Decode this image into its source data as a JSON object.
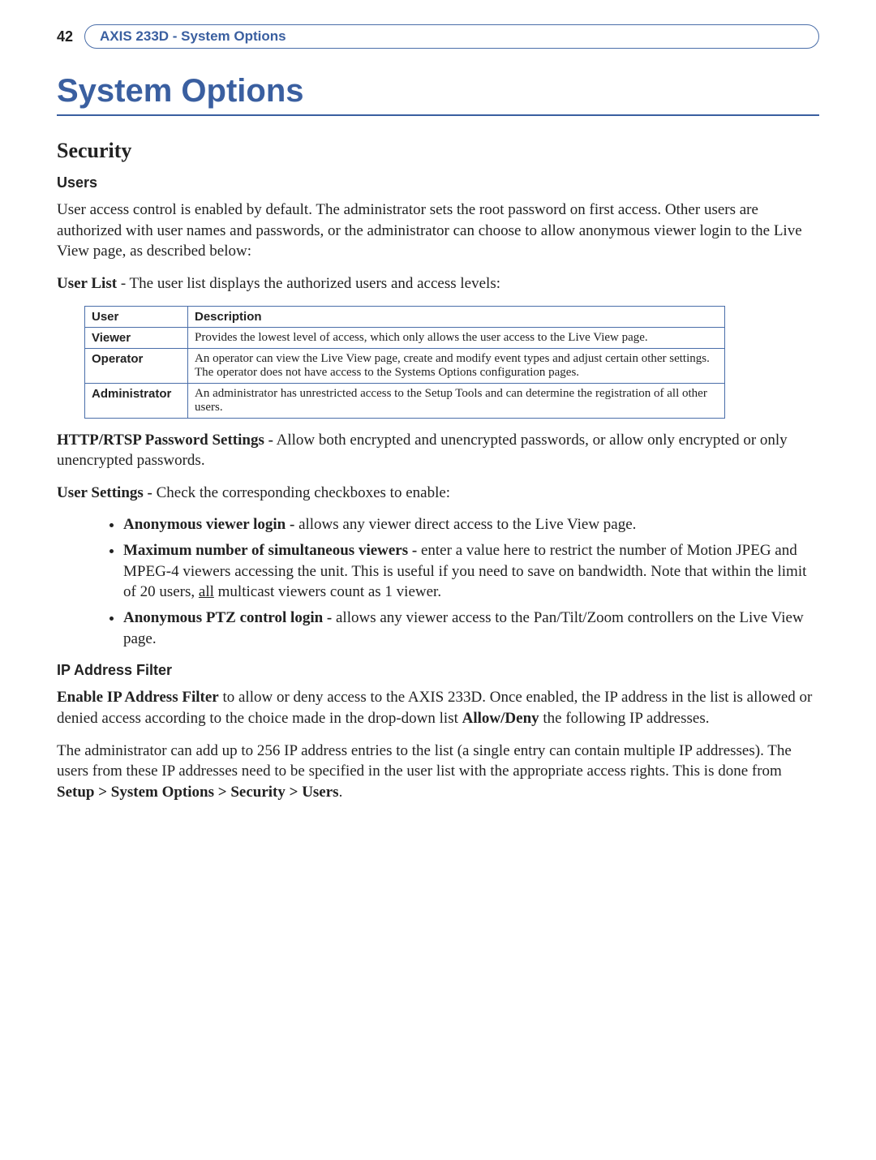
{
  "header": {
    "page_number": "42",
    "running_head": "AXIS 233D - System Options"
  },
  "title": "System Options",
  "security": {
    "heading": "Security",
    "users": {
      "subheading": "Users",
      "intro": "User access control is enabled by default. The administrator sets the root password on first access. Other users are authorized with user names and passwords, or the administrator can choose to allow anonymous viewer login to the Live View page, as described below:",
      "user_list_prefix": "User List",
      "user_list_rest": " - The user list displays the authorized users and access levels:",
      "table": {
        "head_user": "User",
        "head_desc": "Description",
        "rows": [
          {
            "role": "Viewer",
            "desc": "Provides the lowest level of access, which only allows the user access to the Live View page."
          },
          {
            "role": "Operator",
            "desc": "An operator can view the Live View page, create and modify event types and adjust certain other settings. The operator does not have access to the Systems Options configuration pages."
          },
          {
            "role": "Administrator",
            "desc": "An administrator has unrestricted access to the Setup Tools and can determine the registration of all other users."
          }
        ]
      },
      "http_rtsp_prefix": "HTTP/RTSP Password Settings -",
      "http_rtsp_rest": " Allow both encrypted and unencrypted passwords, or allow only encrypted or only unencrypted passwords.",
      "user_settings_prefix": "User Settings -",
      "user_settings_rest": " Check the corresponding checkboxes to enable:",
      "bullets": [
        {
          "lead": "Anonymous viewer login - ",
          "rest": "allows any viewer direct access to the Live View page."
        },
        {
          "lead": "Maximum number of simultaneous viewers - ",
          "rest_a": "enter a value here to restrict the number of Motion JPEG and MPEG-4 viewers accessing the unit. This is useful if you need to save on bandwidth. Note that within the limit of 20 users, ",
          "underlined": "all",
          "rest_b": " multicast viewers count as 1 viewer."
        },
        {
          "lead": "Anonymous PTZ control login - ",
          "rest": "allows any viewer access to the Pan/Tilt/Zoom controllers on the Live View page."
        }
      ]
    },
    "ip_filter": {
      "subheading": "IP Address Filter",
      "para1_prefix": "Enable IP Address Filter",
      "para1_mid": " to allow or deny access to the AXIS 233D. Once enabled, the IP address in the list is allowed or denied access according to the choice made in the drop-down list ",
      "para1_bold2": "Allow/Deny",
      "para1_end": " the following IP addresses.",
      "para2_a": "The administrator can add up to 256 IP address entries to the list (a single entry can contain multiple IP addresses). The users from these IP addresses need to be specified in the user list with the appropriate access rights. This is done from ",
      "para2_path": "Setup > System Options > Security > Users",
      "para2_end": "."
    }
  }
}
